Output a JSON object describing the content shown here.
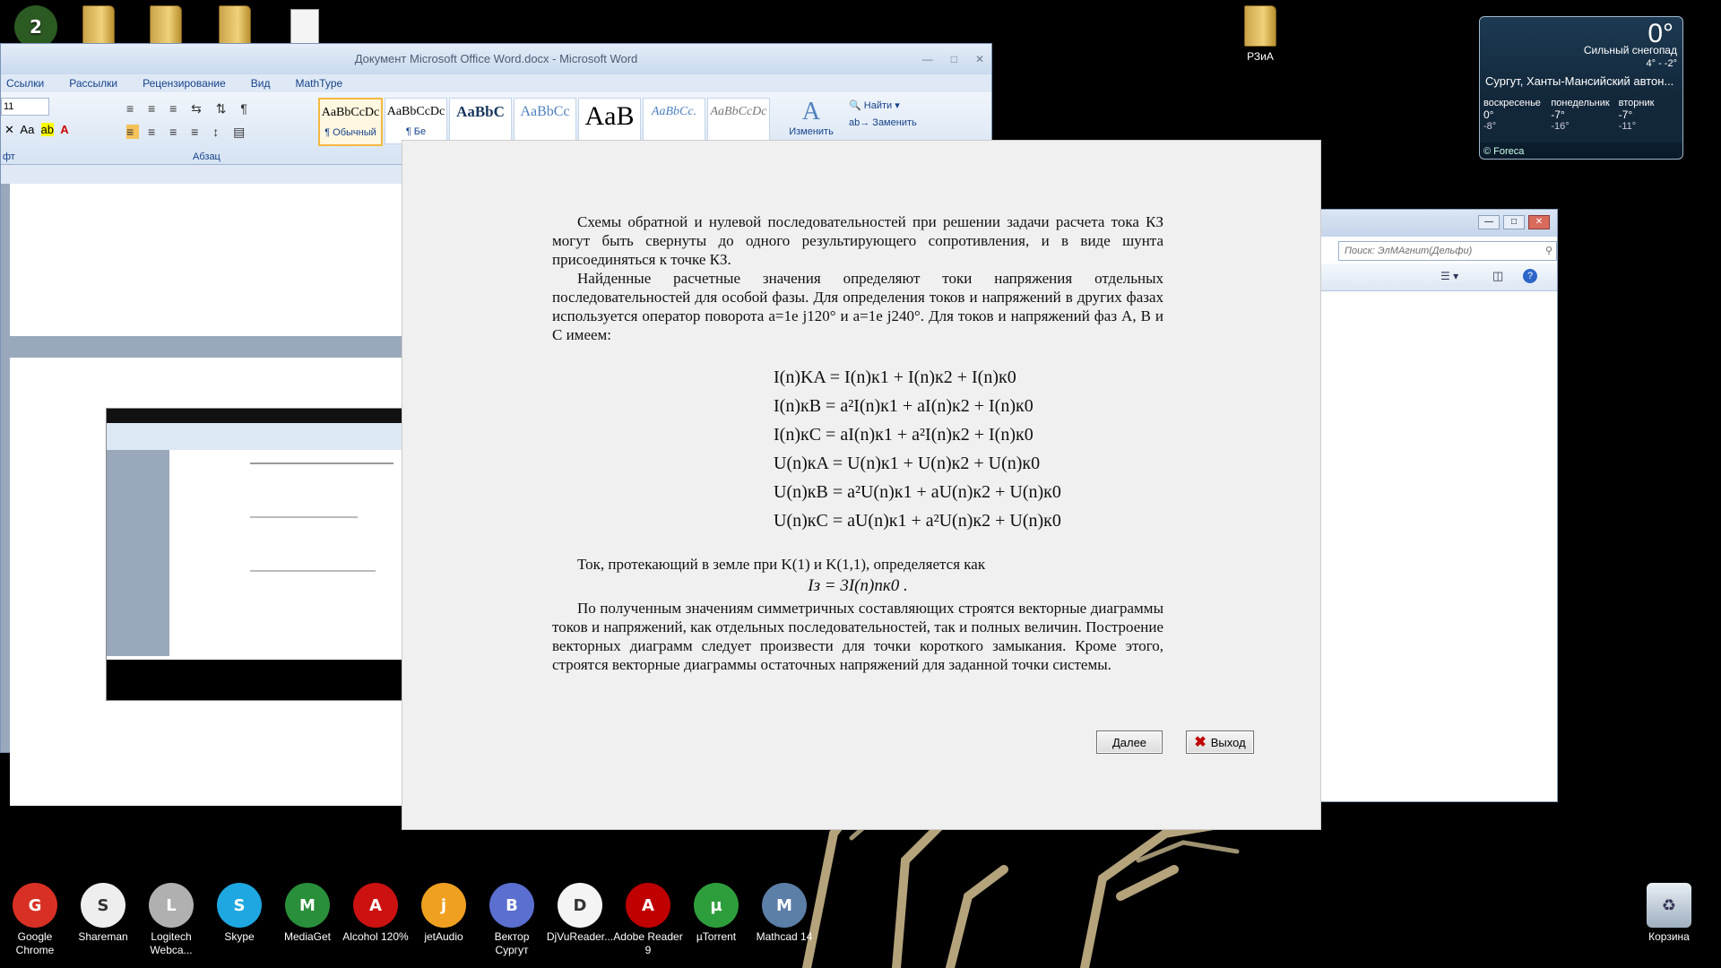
{
  "desktop": {
    "top_folder_label": "РЗиА",
    "recycle_label": "Корзина"
  },
  "word": {
    "title": "Документ Microsoft Office Word.docx - Microsoft Word",
    "menu": [
      "Ссылки",
      "Рассылки",
      "Рецензирование",
      "Вид",
      "MathType"
    ],
    "font_size": "11",
    "styles": [
      "AaBbCcDc",
      "AaBbCcDc",
      "AaBbC",
      "AaBbCc",
      "AaB",
      "AaBbCc.",
      "AaBbCcDc"
    ],
    "style_caption": "¶ Обычный",
    "style_caption2": "¶ Бе",
    "change_styles": "Изменить",
    "find": "Найти",
    "replace": "Заменить",
    "group_font": "фт",
    "group_paragraph": "Абзац"
  },
  "explorer": {
    "search_placeholder": "Поиск: ЭлМАгнит(Дельфи)"
  },
  "weather": {
    "temp": "0°",
    "condition": "Сильный снегопад",
    "range": "4° - -2°",
    "city": "Сургут, Ханты-Мансийский автон...",
    "days": [
      {
        "name": "воскресенье",
        "hi": "0°",
        "lo": "-8°"
      },
      {
        "name": "понедельник",
        "hi": "-7°",
        "lo": "-16°"
      },
      {
        "name": "вторник",
        "hi": "-7°",
        "lo": "-11°"
      }
    ],
    "provider": "© Foreca"
  },
  "dialog": {
    "para1": "Схемы обратной и нулевой последовательностей при решении задачи расчета тока КЗ могут быть свернуты до одного результирующего сопротивления, и в виде шунта присоединяться к точке КЗ.",
    "para2": "Найденные расчетные значения определяют токи напряжения отдельных последовательностей для особой фазы. Для определения токов и напряжений в других фазах используется оператор поворота a=1e j120° и a=1e j240°. Для токов и напряжений фаз А, В и С имеем:",
    "formulas": [
      "I(n)KA = I(n)к1 + I(n)к2 + I(n)к0",
      "I(n)кB = a²I(n)к1 + aI(n)к2 + I(n)к0",
      "I(n)кC = aI(n)к1 + a²I(n)к2 + I(n)к0",
      "U(n)кA = U(n)к1 + U(n)к2 + U(n)к0",
      "U(n)кB = a²U(n)к1 + aU(n)к2 + U(n)к0",
      "U(n)кC = aU(n)к1 + a²U(n)к2 + U(n)к0"
    ],
    "para3": "Ток, протекающий в земле при K(1) и K(1,1), определяется как",
    "formula_ground": "Iз = 3I(n)пк0 .",
    "para4": "По полученным значениям симметричных составляющих строятся векторные диаграммы токов и напряжений, как отдельных последовательностей, так и полных величин. Построение векторных диаграмм следует произвести для точки короткого замыкания. Кроме этого, строятся векторные диаграммы остаточных напряжений для заданной точки системы.",
    "next_button": "Далее",
    "exit_button": "Выход"
  },
  "taskbar": [
    {
      "label": "Google Chrome",
      "icon": "chrome-icon",
      "color": "#d93025"
    },
    {
      "label": "Shareman",
      "icon": "shareman-icon",
      "color": "#eeeeee"
    },
    {
      "label": "Logitech Webca...",
      "icon": "webcam-icon",
      "color": "#b0b0b0"
    },
    {
      "label": "Skype",
      "icon": "skype-icon",
      "color": "#1ea7e1"
    },
    {
      "label": "MediaGet",
      "icon": "mediaget-icon",
      "color": "#2a8f3a"
    },
    {
      "label": "Alcohol 120%",
      "icon": "alcohol-icon",
      "color": "#cc1111"
    },
    {
      "label": "jetAudio",
      "icon": "jetaudio-icon",
      "color": "#f0a020"
    },
    {
      "label": "Вектор Сургут",
      "icon": "vector-icon",
      "color": "#5a6fd0"
    },
    {
      "label": "DjVuReader...",
      "icon": "djvu-icon",
      "color": "#f4f4f4"
    },
    {
      "label": "Adobe Reader 9",
      "icon": "adobe-reader-icon",
      "color": "#c00000"
    },
    {
      "label": "µTorrent",
      "icon": "utorrent-icon",
      "color": "#2e9e3c"
    },
    {
      "label": "Mathcad 14",
      "icon": "mathcad-icon",
      "color": "#5c7fa8"
    }
  ]
}
